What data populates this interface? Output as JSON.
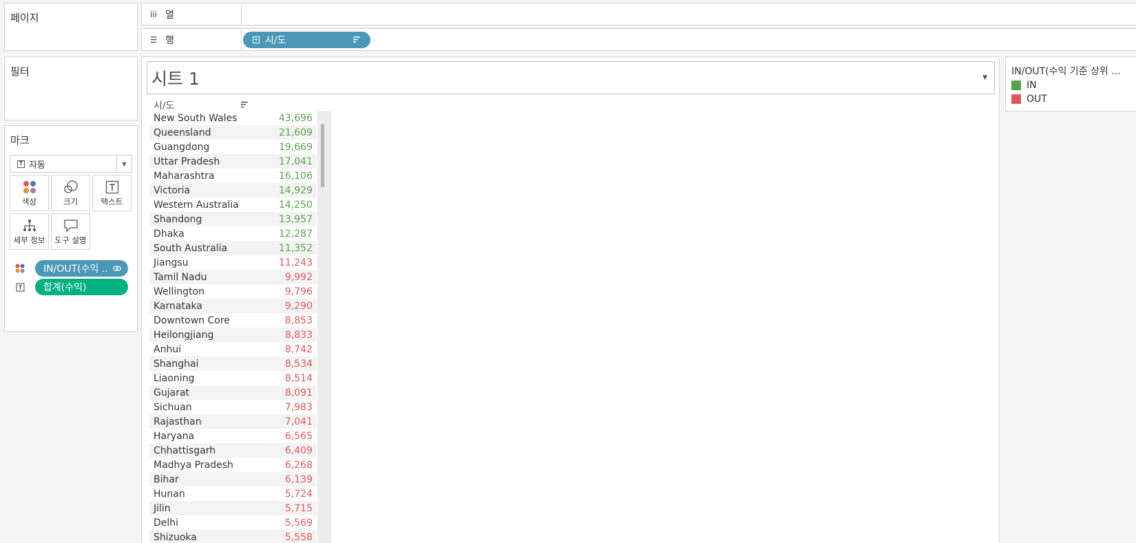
{
  "left_panel": {
    "pages_title": "페이지",
    "filters_title": "필터",
    "marks_title": "마크",
    "mark_type": "자동",
    "mark_buttons": [
      {
        "label": "색상",
        "icon": "color-dots-icon"
      },
      {
        "label": "크기",
        "icon": "size-circles-icon"
      },
      {
        "label": "텍스트",
        "icon": "text-t-icon"
      },
      {
        "label": "세부 정보",
        "icon": "detail-hierarchy-icon"
      },
      {
        "label": "도구 설명",
        "icon": "tooltip-bubble-icon"
      }
    ],
    "mark_pills": [
      {
        "label": "IN/OUT(수익 ..",
        "icon": "color-dots-icon",
        "color": "#4b97b6"
      },
      {
        "label": "합계(수익)",
        "icon": "text-t-icon",
        "color": "#00b180"
      }
    ]
  },
  "shelves": {
    "columns_label": "열",
    "columns_icon": "iii",
    "rows_label": "행",
    "rows_icon": "☰",
    "rows_pill": "시/도"
  },
  "view": {
    "sheet_title": "시트 1",
    "column_header": "시/도",
    "rows": [
      {
        "name": "New South Wales",
        "value": "43,696",
        "group": "IN"
      },
      {
        "name": "Queensland",
        "value": "21,609",
        "group": "IN"
      },
      {
        "name": "Guangdong",
        "value": "19,669",
        "group": "IN"
      },
      {
        "name": "Uttar Pradesh",
        "value": "17,041",
        "group": "IN"
      },
      {
        "name": "Maharashtra",
        "value": "16,106",
        "group": "IN"
      },
      {
        "name": "Victoria",
        "value": "14,929",
        "group": "IN"
      },
      {
        "name": "Western Australia",
        "value": "14,250",
        "group": "IN"
      },
      {
        "name": "Shandong",
        "value": "13,957",
        "group": "IN"
      },
      {
        "name": "Dhaka",
        "value": "12,287",
        "group": "IN"
      },
      {
        "name": "South Australia",
        "value": "11,352",
        "group": "IN"
      },
      {
        "name": "Jiangsu",
        "value": "11,243",
        "group": "OUT"
      },
      {
        "name": "Tamil Nadu",
        "value": "9,992",
        "group": "OUT"
      },
      {
        "name": "Wellington",
        "value": "9,796",
        "group": "OUT"
      },
      {
        "name": "Karnataka",
        "value": "9,290",
        "group": "OUT"
      },
      {
        "name": "Downtown Core",
        "value": "8,853",
        "group": "OUT"
      },
      {
        "name": "Heilongjiang",
        "value": "8,833",
        "group": "OUT"
      },
      {
        "name": "Anhui",
        "value": "8,742",
        "group": "OUT"
      },
      {
        "name": "Shanghai",
        "value": "8,534",
        "group": "OUT"
      },
      {
        "name": "Liaoning",
        "value": "8,514",
        "group": "OUT"
      },
      {
        "name": "Gujarat",
        "value": "8,091",
        "group": "OUT"
      },
      {
        "name": "Sichuan",
        "value": "7,983",
        "group": "OUT"
      },
      {
        "name": "Rajasthan",
        "value": "7,041",
        "group": "OUT"
      },
      {
        "name": "Haryana",
        "value": "6,565",
        "group": "OUT"
      },
      {
        "name": "Chhattisgarh",
        "value": "6,409",
        "group": "OUT"
      },
      {
        "name": "Madhya Pradesh",
        "value": "6,268",
        "group": "OUT"
      },
      {
        "name": "Bihar",
        "value": "6,139",
        "group": "OUT"
      },
      {
        "name": "Hunan",
        "value": "5,724",
        "group": "OUT"
      },
      {
        "name": "Jilin",
        "value": "5,715",
        "group": "OUT"
      },
      {
        "name": "Delhi",
        "value": "5,569",
        "group": "OUT"
      },
      {
        "name": "Shizuoka",
        "value": "5,558",
        "group": "OUT"
      }
    ]
  },
  "legend": {
    "title": "IN/OUT(수익 기준 상위 ...",
    "items": [
      {
        "label": "IN",
        "color": "#59a14f"
      },
      {
        "label": "OUT",
        "color": "#e15759"
      }
    ]
  },
  "colors": {
    "in_text": "#59a14f",
    "out_text": "#e15759",
    "dimension_pill": "#4b97b6",
    "measure_pill": "#00b180"
  }
}
